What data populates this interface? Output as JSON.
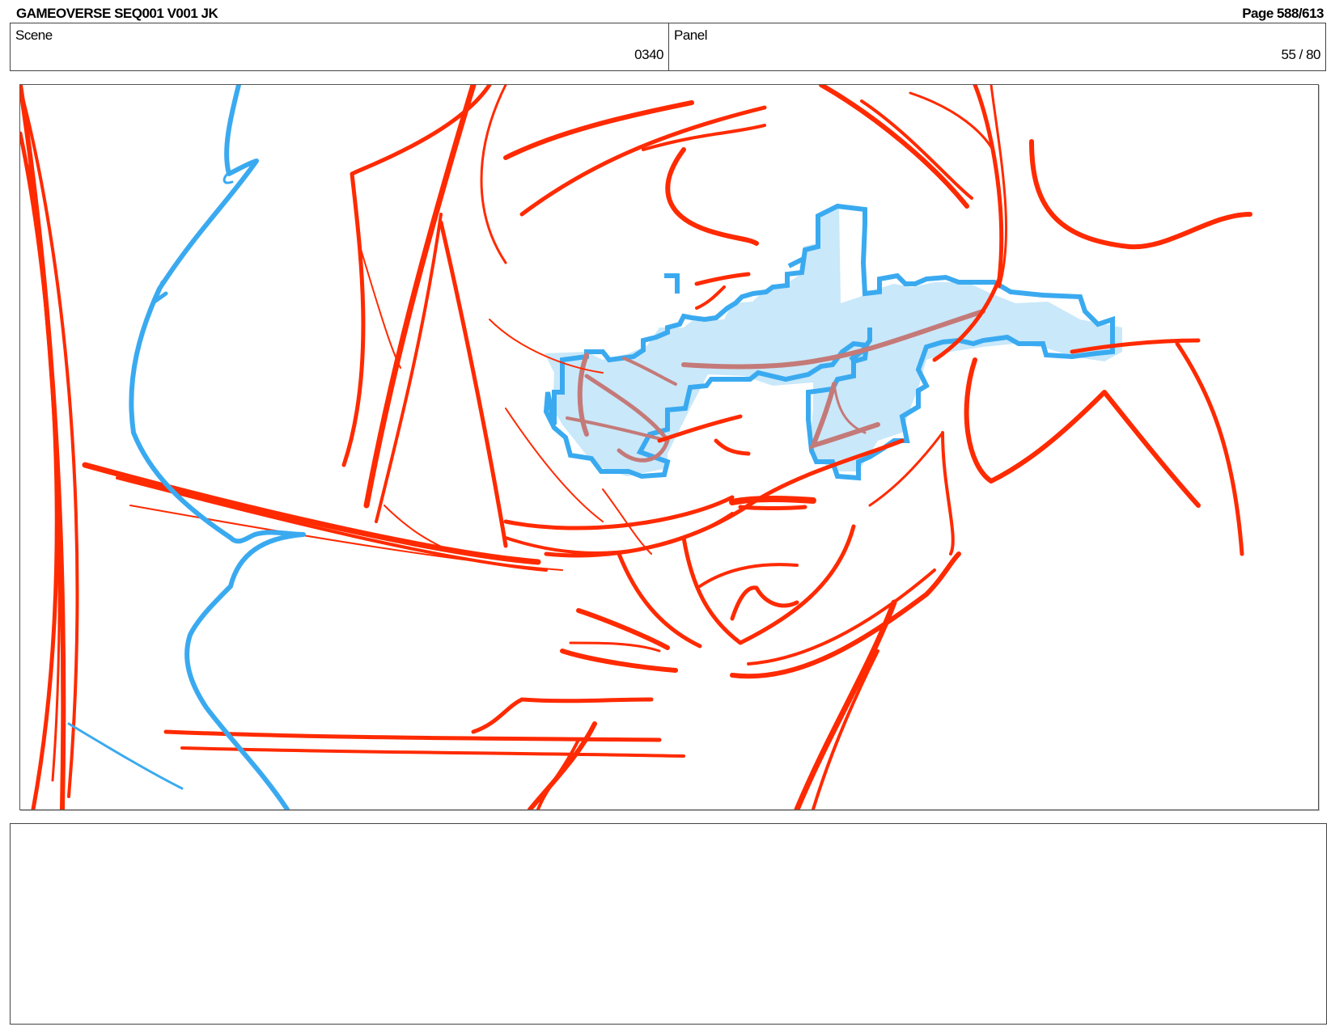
{
  "header": {
    "document_title": "GAMEOVERSE SEQ001 V001 JK",
    "page_indicator": "Page 588/613"
  },
  "info_bar": {
    "scene_label": "Scene",
    "scene_value": "0340",
    "panel_label": "Panel",
    "panel_value": "55 / 80"
  },
  "notes": {
    "text": ""
  },
  "colors": {
    "ink_red": "#ff2a00",
    "ink_blue": "#3aaaf0",
    "fill_blue": "#c9e8fa",
    "ink_mauve": "#c47a78",
    "border": "#444444"
  }
}
